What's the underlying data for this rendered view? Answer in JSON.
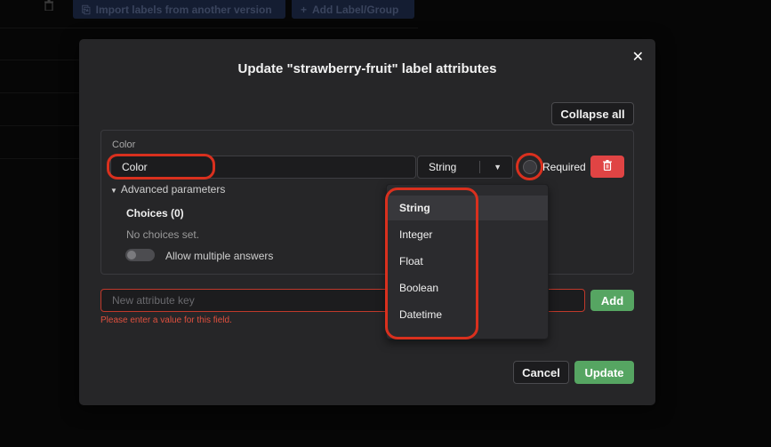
{
  "background": {
    "import_button_label": "Import labels from another version",
    "add_label_button_label": "Add Label/Group"
  },
  "modal": {
    "title": "Update \"strawberry-fruit\" label attributes",
    "collapse_all_label": "Collapse all",
    "attribute": {
      "label": "Color",
      "key_value": "Color",
      "type_value": "String",
      "required_label": "Required",
      "advanced_label": "Advanced parameters",
      "choices_title": "Choices (0)",
      "no_choices_text": "No choices set.",
      "multiple_answers_label": "Allow multiple answers"
    },
    "new_attribute": {
      "placeholder": "New attribute key",
      "error_text": "Please enter a value for this field.",
      "add_label": "Add"
    },
    "cancel_label": "Cancel",
    "update_label": "Update"
  },
  "type_dropdown": {
    "options": [
      "String",
      "Integer",
      "Float",
      "Boolean",
      "Datetime"
    ],
    "selected": "String"
  },
  "colors": {
    "accent_green": "#56a562",
    "danger_red": "#e04444",
    "annotation_red": "#d9301e"
  }
}
